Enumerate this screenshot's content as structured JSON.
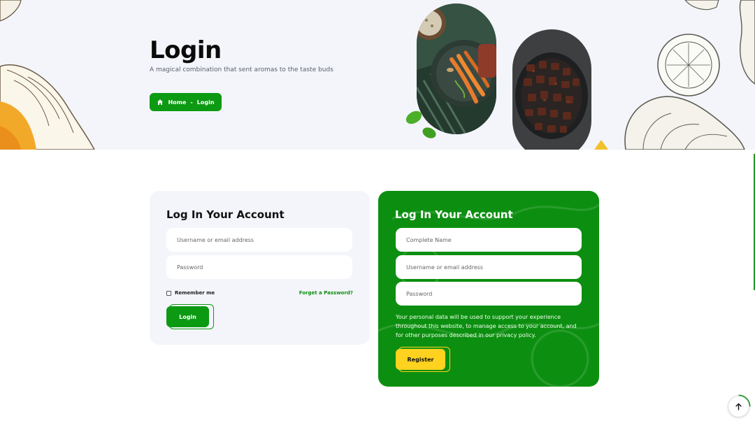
{
  "hero": {
    "title": "Login",
    "subtitle": "A magical combination that sent aromas to the taste buds",
    "breadcrumb": {
      "home": "Home",
      "separator": "-",
      "current": "Login"
    }
  },
  "login_card": {
    "title": "Log In Your Account",
    "username_placeholder": "Username or email address",
    "password_placeholder": "Password",
    "remember_label": "Remember me",
    "forgot_label": "Forget a Password?",
    "submit_label": "Login"
  },
  "register_card": {
    "title": "Log In Your Account",
    "name_placeholder": "Complete Name",
    "username_placeholder": "Username or email address",
    "password_placeholder": "Password",
    "privacy_text": "Your personal data will be used to support your experience throughout this website, to manage access to your account, and for other purposes described in our privacy policy.",
    "submit_label": "Register"
  },
  "colors": {
    "brand_green": "#0c9a12",
    "accent_yellow": "#ffd21f",
    "hero_bg": "#f3f5fa"
  },
  "icons": {
    "breadcrumb": "home-icon",
    "scroll_top": "arrow-up-icon"
  }
}
